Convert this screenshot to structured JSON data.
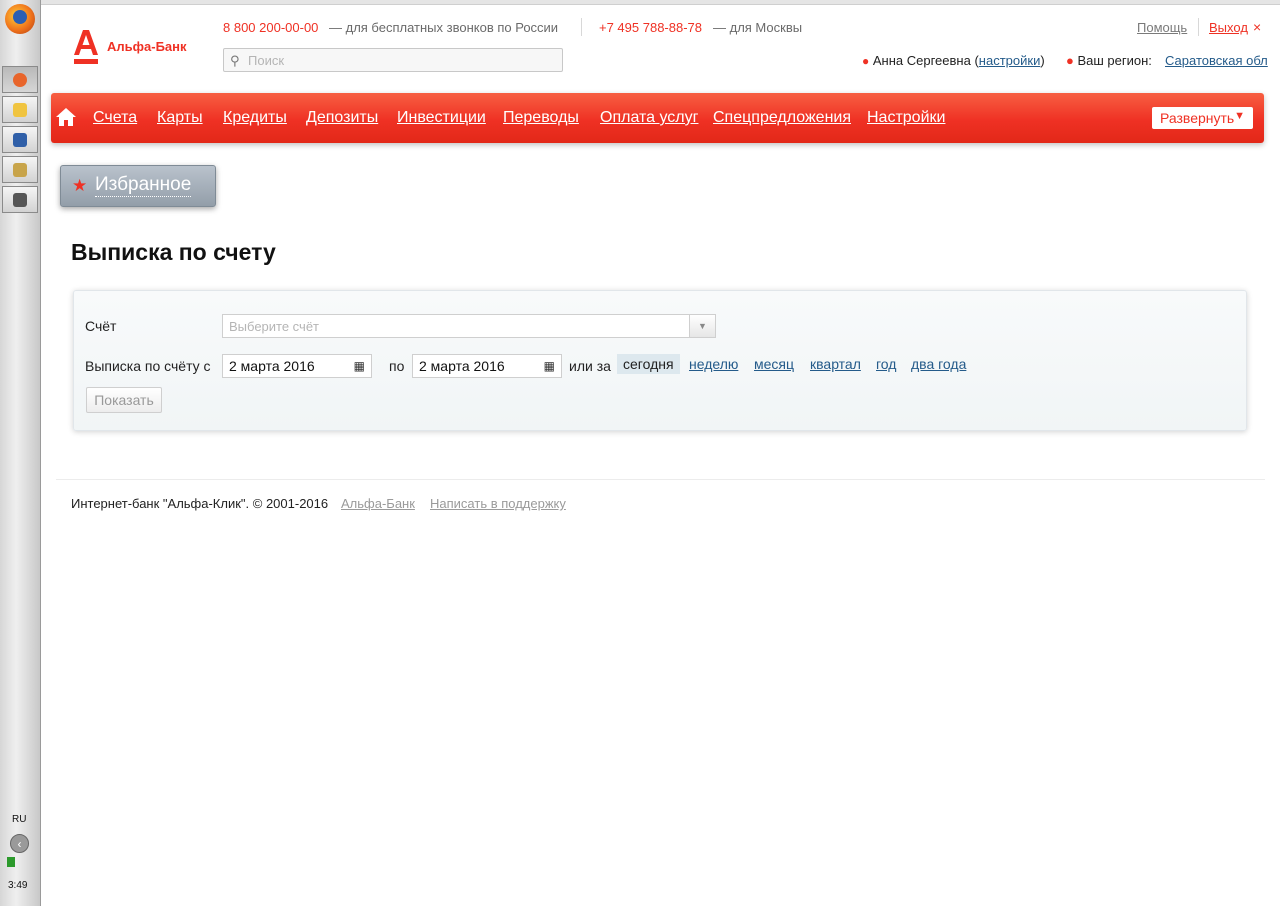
{
  "taskbar": {
    "language": "RU",
    "clock": "3:49"
  },
  "header": {
    "logo_text": "Альфа-Банк",
    "phone_free": "8 800 200-00-00",
    "phone_free_desc": "— для бесплатных звонков по России",
    "phone_moscow": "+7 495 788-88-78",
    "phone_moscow_desc": "— для Москвы",
    "search_placeholder": "Поиск",
    "help": "Помощь",
    "exit": "Выход",
    "user_name": "Анна Сергеевна",
    "settings_open": "(",
    "settings_link": "настройки",
    "settings_close": ")",
    "region_label": "Ваш регион:",
    "region_value": "Саратовская обл"
  },
  "nav": {
    "items": [
      "Счета",
      "Карты",
      "Кредиты",
      "Депозиты",
      "Инвестиции",
      "Переводы",
      "Оплата услуг",
      "Спецпредложения",
      "Настройки"
    ],
    "expand_label": "Развернуть",
    "brand_color": "#ef3124"
  },
  "favorites": {
    "label": "Избранное"
  },
  "page": {
    "title": "Выписка по счету"
  },
  "form": {
    "account_label": "Счёт",
    "account_placeholder": "Выберите счёт",
    "period_from_label": "Выписка по счёту с",
    "date_from": "2 марта 2016",
    "to_label": "по",
    "date_to": "2 марта 2016",
    "or_label": "или за",
    "periods": [
      "сегодня",
      "неделю",
      "месяц",
      "квартал",
      "год",
      "два года"
    ],
    "active_period": "сегодня",
    "show_button": "Показать"
  },
  "footer": {
    "copyright": "Интернет-банк \"Альфа-Клик\". © 2001-2016",
    "bank_link": "Альфа-Банк",
    "support_link": "Написать в поддержку"
  }
}
